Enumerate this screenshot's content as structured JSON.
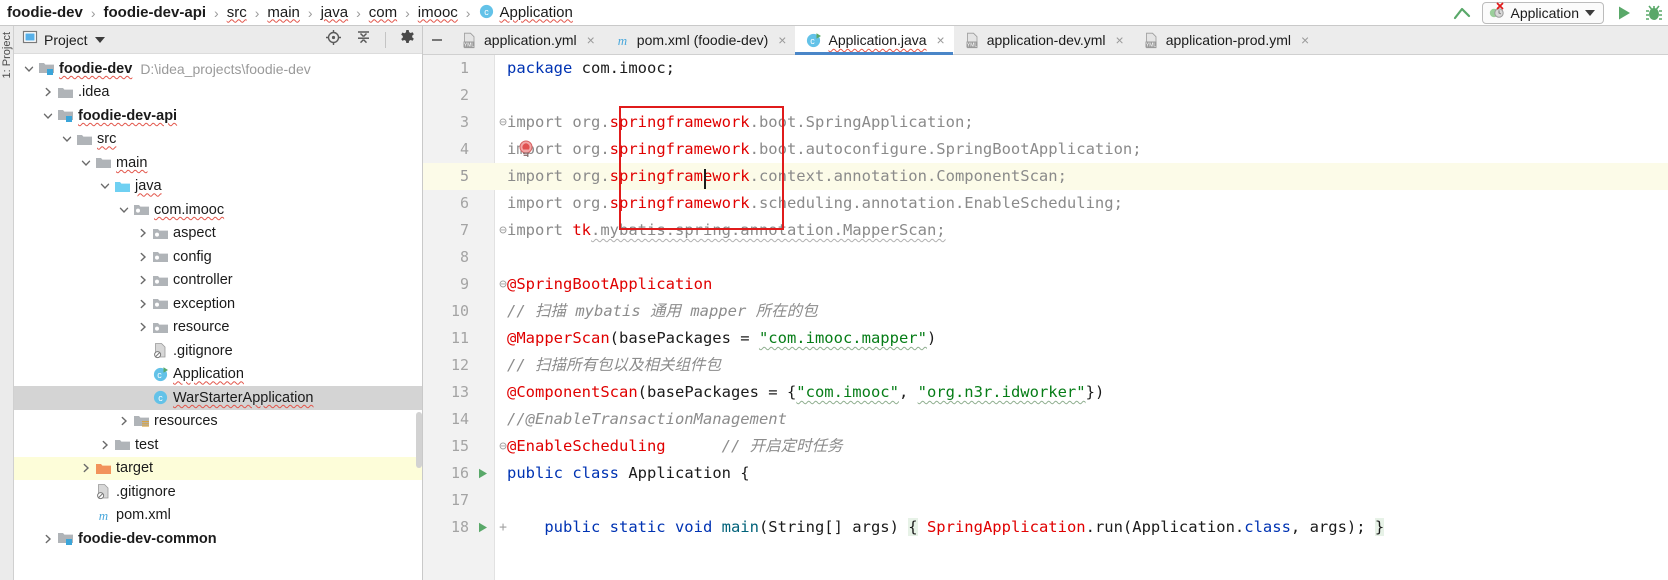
{
  "breadcrumb": {
    "items": [
      {
        "label": "foodie-dev",
        "bold": true,
        "squiggle": false,
        "icon": null
      },
      {
        "label": "foodie-dev-api",
        "bold": true,
        "squiggle": false,
        "icon": null
      },
      {
        "label": "src",
        "bold": false,
        "squiggle": true,
        "icon": null
      },
      {
        "label": "main",
        "bold": false,
        "squiggle": true,
        "icon": null
      },
      {
        "label": "java",
        "bold": false,
        "squiggle": true,
        "icon": null
      },
      {
        "label": "com",
        "bold": false,
        "squiggle": true,
        "icon": null
      },
      {
        "label": "imooc",
        "bold": false,
        "squiggle": true,
        "icon": null
      },
      {
        "label": "Application",
        "bold": false,
        "squiggle": true,
        "icon": "java-class-icon"
      }
    ],
    "separator": "›"
  },
  "toolbar": {
    "jump_up_icon": "arrow-up-icon",
    "run_config_name": "Application",
    "run_config_icon": "run-config-error-icon",
    "dropdown_icon": "chevron-down-icon",
    "run_icon": "run-icon",
    "debug_icon": "debug-icon"
  },
  "left_strip": {
    "label": "1: Project"
  },
  "project_panel": {
    "title": "Project",
    "title_dropdown_icon": "chevron-down-icon",
    "view_icon": "project-view-icon",
    "locate_icon": "locate-target-icon",
    "collapse_icon": "collapse-all-icon",
    "settings_icon": "gear-icon",
    "tree": [
      {
        "indent": 0,
        "twist": "down",
        "icon": "module-folder-icon",
        "label": "foodie-dev",
        "bold": true,
        "squiggle": true,
        "path": "D:\\idea_projects\\foodie-dev",
        "state": "normal"
      },
      {
        "indent": 1,
        "twist": "right",
        "icon": "folder-icon",
        "label": ".idea",
        "bold": false,
        "squiggle": false,
        "path": "",
        "state": "normal"
      },
      {
        "indent": 1,
        "twist": "down",
        "icon": "module-folder-icon",
        "label": "foodie-dev-api",
        "bold": true,
        "squiggle": true,
        "path": "",
        "state": "normal"
      },
      {
        "indent": 2,
        "twist": "down",
        "icon": "folder-icon",
        "label": "src",
        "bold": false,
        "squiggle": true,
        "path": "",
        "state": "normal"
      },
      {
        "indent": 3,
        "twist": "down",
        "icon": "folder-icon",
        "label": "main",
        "bold": false,
        "squiggle": true,
        "path": "",
        "state": "normal"
      },
      {
        "indent": 4,
        "twist": "down",
        "icon": "source-folder-icon",
        "label": "java",
        "bold": false,
        "squiggle": true,
        "path": "",
        "state": "normal"
      },
      {
        "indent": 5,
        "twist": "down",
        "icon": "package-icon",
        "label": "com.imooc",
        "bold": false,
        "squiggle": true,
        "path": "",
        "state": "normal"
      },
      {
        "indent": 6,
        "twist": "right",
        "icon": "package-icon",
        "label": "aspect",
        "bold": false,
        "squiggle": false,
        "path": "",
        "state": "normal"
      },
      {
        "indent": 6,
        "twist": "right",
        "icon": "package-icon",
        "label": "config",
        "bold": false,
        "squiggle": false,
        "path": "",
        "state": "normal"
      },
      {
        "indent": 6,
        "twist": "right",
        "icon": "package-icon",
        "label": "controller",
        "bold": false,
        "squiggle": false,
        "path": "",
        "state": "normal"
      },
      {
        "indent": 6,
        "twist": "right",
        "icon": "package-icon",
        "label": "exception",
        "bold": false,
        "squiggle": false,
        "path": "",
        "state": "normal"
      },
      {
        "indent": 6,
        "twist": "right",
        "icon": "package-icon",
        "label": "resource",
        "bold": false,
        "squiggle": false,
        "path": "",
        "state": "normal"
      },
      {
        "indent": 6,
        "twist": "none",
        "icon": "gitignore-file-icon",
        "label": ".gitignore",
        "bold": false,
        "squiggle": false,
        "path": "",
        "state": "normal"
      },
      {
        "indent": 6,
        "twist": "none",
        "icon": "java-runnable-class-icon",
        "label": "Application",
        "bold": false,
        "squiggle": true,
        "path": "",
        "state": "normal"
      },
      {
        "indent": 6,
        "twist": "none",
        "icon": "java-class-icon",
        "label": "WarStarterApplication",
        "bold": false,
        "squiggle": true,
        "path": "",
        "state": "selected"
      },
      {
        "indent": 5,
        "twist": "right",
        "icon": "resources-folder-icon",
        "label": "resources",
        "bold": false,
        "squiggle": false,
        "path": "",
        "state": "normal"
      },
      {
        "indent": 4,
        "twist": "right",
        "icon": "folder-icon",
        "label": "test",
        "bold": false,
        "squiggle": false,
        "path": "",
        "state": "normal"
      },
      {
        "indent": 3,
        "twist": "right",
        "icon": "target-folder-icon",
        "label": "target",
        "bold": false,
        "squiggle": false,
        "path": "",
        "state": "highlighted"
      },
      {
        "indent": 3,
        "twist": "none",
        "icon": "gitignore-file-icon",
        "label": ".gitignore",
        "bold": false,
        "squiggle": false,
        "path": "",
        "state": "normal"
      },
      {
        "indent": 3,
        "twist": "none",
        "icon": "maven-file-icon",
        "label": "pom.xml",
        "bold": false,
        "squiggle": false,
        "path": "",
        "state": "normal"
      },
      {
        "indent": 1,
        "twist": "right",
        "icon": "module-folder-icon",
        "label": "foodie-dev-common",
        "bold": true,
        "squiggle": false,
        "path": "",
        "state": "normal"
      }
    ]
  },
  "editor_tabs": {
    "hide_icon": "minimize-icon",
    "close_label": "×",
    "items": [
      {
        "label": "application.yml",
        "icon": "yml-file-icon",
        "active": false,
        "squiggle": false
      },
      {
        "label": "pom.xml (foodie-dev)",
        "icon": "maven-file-icon",
        "active": false,
        "squiggle": false
      },
      {
        "label": "Application.java",
        "icon": "java-runnable-class-icon",
        "active": true,
        "squiggle": true
      },
      {
        "label": "application-dev.yml",
        "icon": "yml-file-icon",
        "active": false,
        "squiggle": false
      },
      {
        "label": "application-prod.yml",
        "icon": "yml-file-icon",
        "active": false,
        "squiggle": false
      }
    ]
  },
  "editor": {
    "file": "Application.java",
    "current_line": 5,
    "highlight_box": {
      "label": "springframework-occurrences-highlight",
      "color": "#e01b1b"
    },
    "lines": [
      {
        "n": "1",
        "fold": "",
        "gutter": "",
        "current": false
      },
      {
        "n": "2",
        "fold": "",
        "gutter": "",
        "current": false
      },
      {
        "n": "3",
        "fold": "⊖",
        "gutter": "",
        "current": false
      },
      {
        "n": "4",
        "fold": "",
        "gutter": "",
        "current": false
      },
      {
        "n": "5",
        "fold": "",
        "gutter": "",
        "current": true
      },
      {
        "n": "6",
        "fold": "",
        "gutter": "",
        "current": false
      },
      {
        "n": "7",
        "fold": "⊖",
        "gutter": "",
        "current": false
      },
      {
        "n": "8",
        "fold": "",
        "gutter": "",
        "current": false
      },
      {
        "n": "9",
        "fold": "⊖",
        "gutter": "",
        "current": false
      },
      {
        "n": "10",
        "fold": "",
        "gutter": "",
        "current": false
      },
      {
        "n": "11",
        "fold": "",
        "gutter": "",
        "current": false
      },
      {
        "n": "12",
        "fold": "",
        "gutter": "",
        "current": false
      },
      {
        "n": "13",
        "fold": "",
        "gutter": "",
        "current": false
      },
      {
        "n": "14",
        "fold": "",
        "gutter": "",
        "current": false
      },
      {
        "n": "15",
        "fold": "⊖",
        "gutter": "",
        "current": false
      },
      {
        "n": "16",
        "fold": "",
        "gutter": "run-gutter-icon",
        "current": false
      },
      {
        "n": "17",
        "fold": "",
        "gutter": "",
        "current": false
      },
      {
        "n": "18",
        "fold": "+",
        "gutter": "run-gutter-icon",
        "current": false
      }
    ],
    "code_text": [
      "package com.imooc;",
      "",
      "import org.springframework.boot.SpringApplication;",
      "import org.springframework.boot.autoconfigure.SpringBootApplication;",
      "import org.springframework.context.annotation.ComponentScan;",
      "import org.springframework.scheduling.annotation.EnableScheduling;",
      "import tk.mybatis.spring.annotation.MapperScan;",
      "",
      "@SpringBootApplication",
      "// 扫描 mybatis 通用 mapper 所在的包",
      "@MapperScan(basePackages = \"com.imooc.mapper\")",
      "// 扫描所有包以及相关组件包",
      "@ComponentScan(basePackages = {\"com.imooc\", \"org.n3r.idworker\"})",
      "//@EnableTransactionManagement",
      "@EnableScheduling      // 开启定时任务",
      "public class Application {",
      "",
      "    public static void main(String[] args) { SpringApplication.run(Application.class, args); }"
    ],
    "tokens": {
      "t1_kw": "package",
      "t1_rest": " com.imooc;",
      "t3_import": "import org.",
      "t3_sf": "springframework",
      "t3_rest": ".boot.SpringApplication;",
      "t4_import": "import org.",
      "t4_sf": "springframework",
      "t4_rest": ".boot.autoconfigure.SpringBootApplication;",
      "t5_import": "import org.",
      "t5_sf": "springframework",
      "t5_rest": ".context.annotation.ComponentScan;",
      "t6_import": "import org.",
      "t6_sf": "springframework",
      "t6_rest": ".scheduling.annotation.EnableScheduling;",
      "t7_import": "import ",
      "t7_tk": "tk",
      "t7_rest": ".mybatis.spring.annotation.MapperScan;",
      "t9_ann": "@SpringBootApplication",
      "t10_cmt": "// 扫描 mybatis 通用 mapper 所在的包",
      "t11_ann": "@MapperScan",
      "t11_open": "(basePackages = ",
      "t11_str": "\"com.imooc.mapper\"",
      "t11_close": ")",
      "t12_cmt": "// 扫描所有包以及相关组件包",
      "t13_ann": "@ComponentScan",
      "t13_open": "(basePackages = {",
      "t13_str1": "\"com.imooc\"",
      "t13_mid": ", ",
      "t13_str2": "\"org.n3r.idworker\"",
      "t13_close": "})",
      "t14_cmt": "//@EnableTransactionManagement",
      "t15_ann": "@EnableScheduling",
      "t15_gap": "      ",
      "t15_cmt": "// 开启定时任务",
      "t16_kw": "public class ",
      "t16_name": "Application {",
      "t18_indent": "    ",
      "t18_kw1": "public static void ",
      "t18_main": "main",
      "t18_args": "(String[] args) ",
      "t18_brace1": "{",
      "t18_sp": " ",
      "t18_sa": "SpringApplication",
      "t18_run": ".run(Application.",
      "t18_class": "class",
      "t18_tail": ", args); ",
      "t18_brace2": "}"
    }
  },
  "colors": {
    "keyword": "#0033b3",
    "annotation": "#e00000",
    "string": "#067d17",
    "comment": "#8c8c8c",
    "unused_import": "#8a8a8a",
    "highlight_box": "#e01b1b",
    "tab_active_underline": "#4a86c8",
    "current_line_bg": "#fcfbe8",
    "selection_bg": "#d4d4d4",
    "target_folder_bg": "#fdfdd9"
  }
}
